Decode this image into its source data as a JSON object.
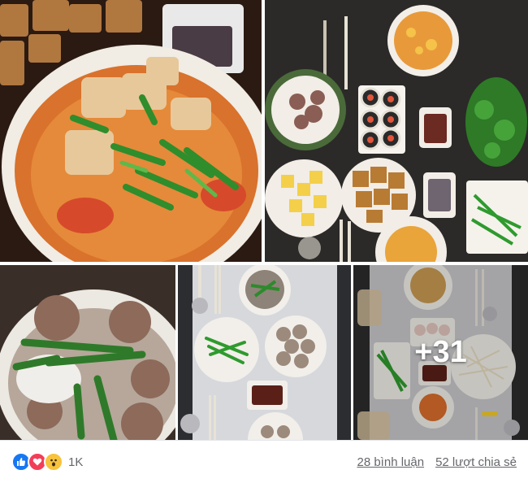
{
  "photos": [
    {
      "id": "photo-1",
      "description": "bowl of noodle soup with fried tofu and scallions"
    },
    {
      "id": "photo-2",
      "description": "table spread with soup, sushi rolls, pineapple, tofu, greens"
    },
    {
      "id": "photo-3",
      "description": "bowl of meatball soup with scallions"
    },
    {
      "id": "photo-4",
      "description": "table with meatball soup and green beans"
    },
    {
      "id": "photo-5",
      "description": "table with soup, eggs, bean sprouts, green beans"
    }
  ],
  "more_photos": "+31",
  "reactions": {
    "icons": [
      "like-icon",
      "love-icon",
      "wow-icon"
    ],
    "count": "1K",
    "colors": {
      "like": "#1877f2",
      "love": "#f33e58",
      "wow": "#f7c23c"
    }
  },
  "stats": {
    "comments": "28 bình luận",
    "shares": "52 lượt chia sẻ"
  }
}
